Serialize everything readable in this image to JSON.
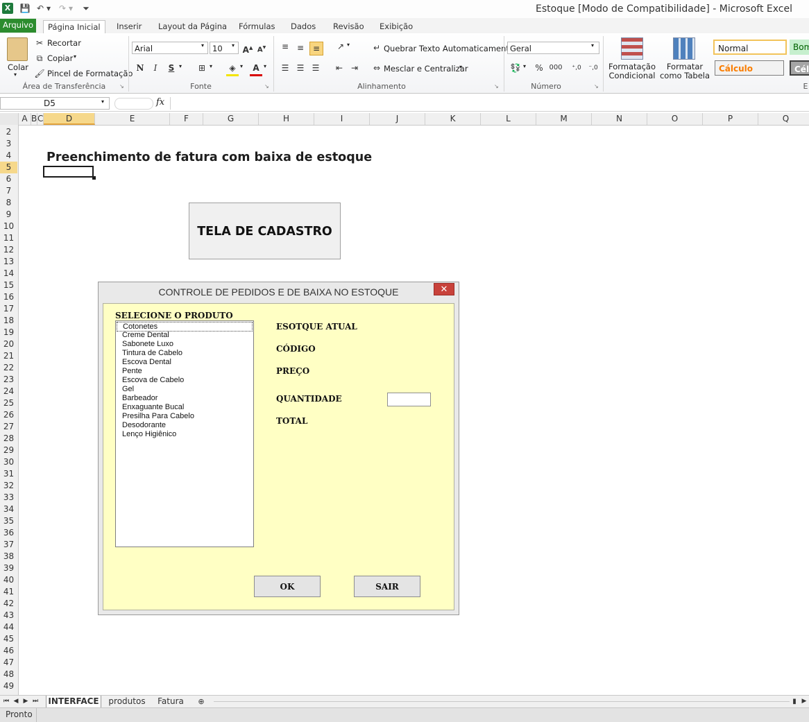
{
  "window": {
    "title": "Estoque  [Modo de Compatibilidade]  -  Microsoft Excel",
    "app_icon": "X"
  },
  "tabs": [
    "Arquivo",
    "Página Inicial",
    "Inserir",
    "Layout da Página",
    "Fórmulas",
    "Dados",
    "Revisão",
    "Exibição"
  ],
  "ribbon": {
    "clipboard": {
      "paste": "Colar",
      "cut": "Recortar",
      "copy": "Copiar",
      "format_painter": "Pincel de Formatação",
      "label": "Área de Transferência"
    },
    "font": {
      "name": "Arial",
      "size": "10",
      "bold": "N",
      "italic": "I",
      "underline": "S",
      "label": "Fonte"
    },
    "alignment": {
      "wrap": "Quebrar Texto Automaticamente",
      "merge": "Mesclar e Centralizar",
      "label": "Alinhamento"
    },
    "number": {
      "format": "Geral",
      "percent": "%",
      "thousands": "000",
      "label": "Número"
    },
    "styles": {
      "conditional": "Formatação Condicional",
      "as_table": "Formatar como Tabela",
      "normal": "Normal",
      "good": "Bom",
      "calc": "Cálculo",
      "cell": "Célu",
      "label": "E"
    }
  },
  "formula_bar": {
    "name_box": "D5",
    "fx": "fx",
    "content": ""
  },
  "columns": [
    "A",
    "B",
    "C",
    "D",
    "E",
    "F",
    "G",
    "H",
    "I",
    "J",
    "K",
    "L",
    "M",
    "N",
    "O",
    "P",
    "Q"
  ],
  "rows": [
    "2",
    "3",
    "4",
    "5",
    "6",
    "7",
    "8",
    "9",
    "10",
    "11",
    "12",
    "13",
    "14",
    "15",
    "16",
    "17",
    "18",
    "19",
    "20",
    "21",
    "22",
    "23",
    "24",
    "25",
    "26",
    "27",
    "28",
    "29",
    "30",
    "31",
    "32",
    "33",
    "34",
    "35",
    "36",
    "37",
    "38",
    "39",
    "40",
    "41",
    "42",
    "43",
    "44",
    "45",
    "46",
    "47",
    "48",
    "49"
  ],
  "sheet": {
    "heading": "Preenchimento de fatura com baixa de estoque",
    "cadastro_button": "TELA DE CADASTRO"
  },
  "form": {
    "title": "CONTROLE DE PEDIDOS E DE BAIXA NO ESTOQUE",
    "close": "✕",
    "select_label": "SELECIONE O PRODUTO",
    "products": [
      "Cotonetes",
      "Creme Dental",
      "Sabonete Luxo",
      "Tintura de Cabelo",
      "Escova Dental",
      "Pente",
      "Escova de Cabelo",
      "Gel",
      "Barbeador",
      "Enxaguante Bucal",
      "Presilha Para Cabelo",
      "Desodorante",
      "Lenço Higiênico"
    ],
    "stock_label": "ESOTQUE ATUAL",
    "code_label": "CÓDIGO",
    "price_label": "PREÇO",
    "qty_label": "QUANTIDADE",
    "qty_value": "",
    "total_label": "TOTAL",
    "ok": "OK",
    "exit": "SAIR"
  },
  "sheet_tabs": [
    "INTERFACE",
    "produtos",
    "Fatura"
  ],
  "status": "Pronto"
}
